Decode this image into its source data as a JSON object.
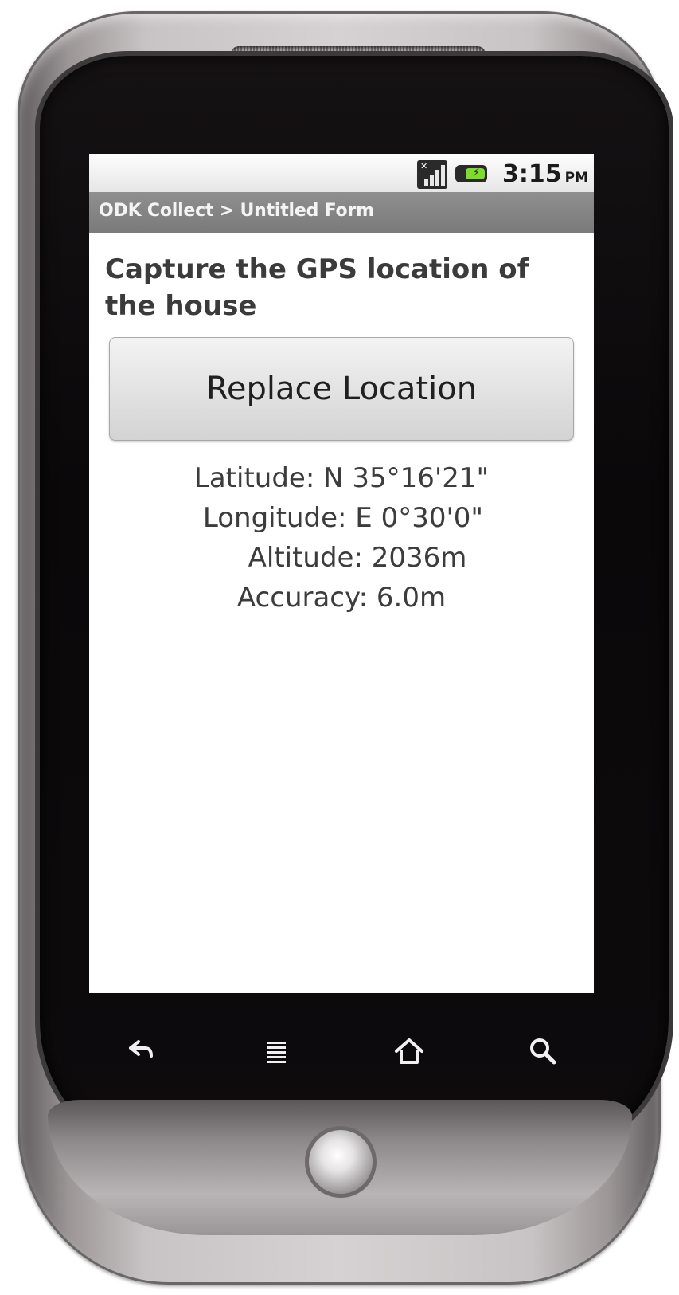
{
  "status_bar": {
    "time": "3:15",
    "ampm": "PM",
    "signal_icon": "signal-no-data-icon",
    "battery_icon": "battery-charging-icon"
  },
  "title_bar": {
    "title": "ODK Collect > Untitled Form"
  },
  "question": {
    "label": "Capture the GPS location of the house"
  },
  "buttons": {
    "replace_location": "Replace Location"
  },
  "gps": {
    "latitude": "Latitude: N 35°16'21\"",
    "longitude": "Longitude: E 0°30'0\"",
    "altitude": "Altitude: 2036m",
    "accuracy": "Accuracy: 6.0m"
  },
  "softkeys": {
    "back": "back-icon",
    "menu": "menu-icon",
    "home": "home-icon",
    "search": "search-icon"
  },
  "colors": {
    "title_bar": "#7d7d7d",
    "screen_bg": "#ffffff",
    "text": "#3b3b3b"
  }
}
